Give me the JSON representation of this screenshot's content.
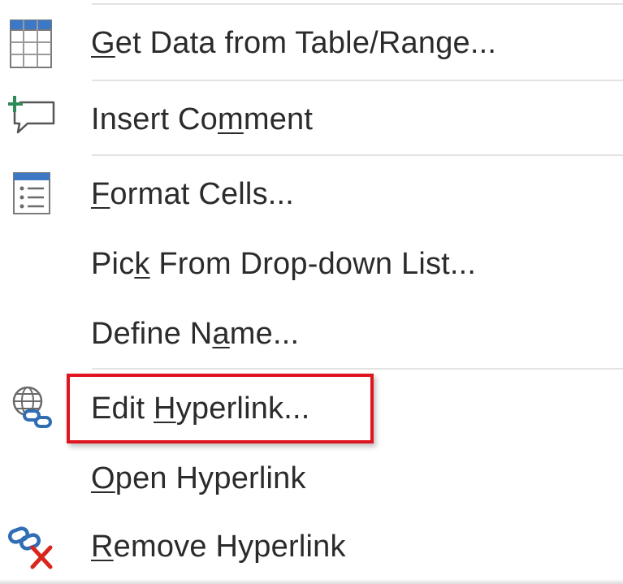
{
  "menu": {
    "items": [
      {
        "before": "",
        "key": "G",
        "after": "et Data from Table/Range...",
        "icon": "table-icon"
      },
      {
        "before": "Insert Co",
        "key": "m",
        "after": "ment",
        "icon": "insert-comment-icon"
      },
      {
        "before": "",
        "key": "F",
        "after": "ormat Cells...",
        "icon": "format-cells-icon"
      },
      {
        "before": "Pic",
        "key": "k",
        "after": " From Drop-down List...",
        "icon": ""
      },
      {
        "before": "Define N",
        "key": "a",
        "after": "me...",
        "icon": ""
      },
      {
        "before": "Edit ",
        "key": "H",
        "after": "yperlink...",
        "icon": "globe-link-icon"
      },
      {
        "before": "",
        "key": "O",
        "after": "pen Hyperlink",
        "icon": ""
      },
      {
        "before": "",
        "key": "R",
        "after": "emove Hyperlink",
        "icon": "remove-link-icon"
      }
    ]
  },
  "colors": {
    "text": "#2b2b2b",
    "highlight": "#e0141e",
    "icon_green": "#2e8b57",
    "icon_blue": "#2f6db5",
    "icon_red": "#d9261c"
  }
}
